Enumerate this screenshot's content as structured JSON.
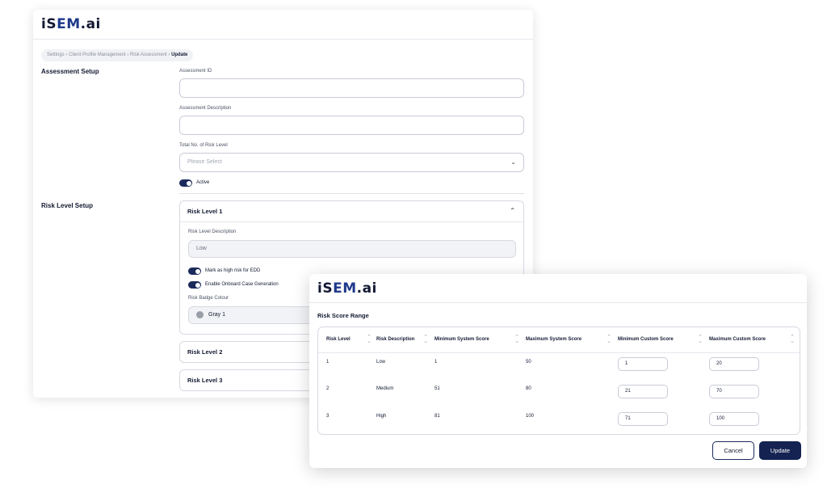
{
  "app": {
    "logo_prefix": "iS",
    "logo_mid": "EM",
    "logo_suffix": ".ai"
  },
  "breadcrumb": {
    "path": "Settings › Client Profile Management › Risk Assessment › ",
    "current": "Update"
  },
  "assessment_setup": {
    "title": "Assessment Setup",
    "assessment_id_label": "Assessment ID",
    "assessment_id_value": "",
    "description_label": "Assessment Description",
    "description_value": "",
    "total_levels_label": "Total No. of Risk Level",
    "total_levels_placeholder": "Please Select",
    "active_label": "Active",
    "active_on": true
  },
  "risk_level_setup": {
    "title": "Risk Level Setup",
    "levels": [
      {
        "label": "Risk Level 1",
        "expanded": true,
        "description_label": "Risk Level Description",
        "description_value": "Low",
        "edd_label": "Mark as high risk for EDD",
        "edd_on": true,
        "onboard_label": "Enable Onboard Case Generation",
        "onboard_on": true,
        "badge_label": "Risk Badge Colour",
        "badge_value": "Gray 1",
        "badge_color": "#9a9ea8"
      },
      {
        "label": "Risk Level 2",
        "expanded": false
      },
      {
        "label": "Risk Level 3",
        "expanded": false
      }
    ]
  },
  "risk_score_range": {
    "title": "Risk Score Range",
    "columns": [
      "Risk Level",
      "Risk Description",
      "Minimum System Score",
      "Maximum System Score",
      "Minimum Custom Score",
      "Maximum Custom Score"
    ],
    "rows": [
      {
        "level": "1",
        "description": "Low",
        "min_system": "1",
        "max_system": "50",
        "min_custom": "1",
        "max_custom": "20"
      },
      {
        "level": "2",
        "description": "Medium",
        "min_system": "51",
        "max_system": "80",
        "min_custom": "21",
        "max_custom": "70"
      },
      {
        "level": "3",
        "description": "High",
        "min_system": "81",
        "max_system": "100",
        "min_custom": "71",
        "max_custom": "100"
      }
    ],
    "cancel_label": "Cancel",
    "update_label": "Update"
  },
  "colors": {
    "primary": "#142352",
    "toggle": "#1b2a5a",
    "border": "#d6d9e1"
  },
  "icons": {
    "dropdown": "chevron-down-icon",
    "collapse": "chevron-up-icon",
    "sort": "sort-icon"
  }
}
